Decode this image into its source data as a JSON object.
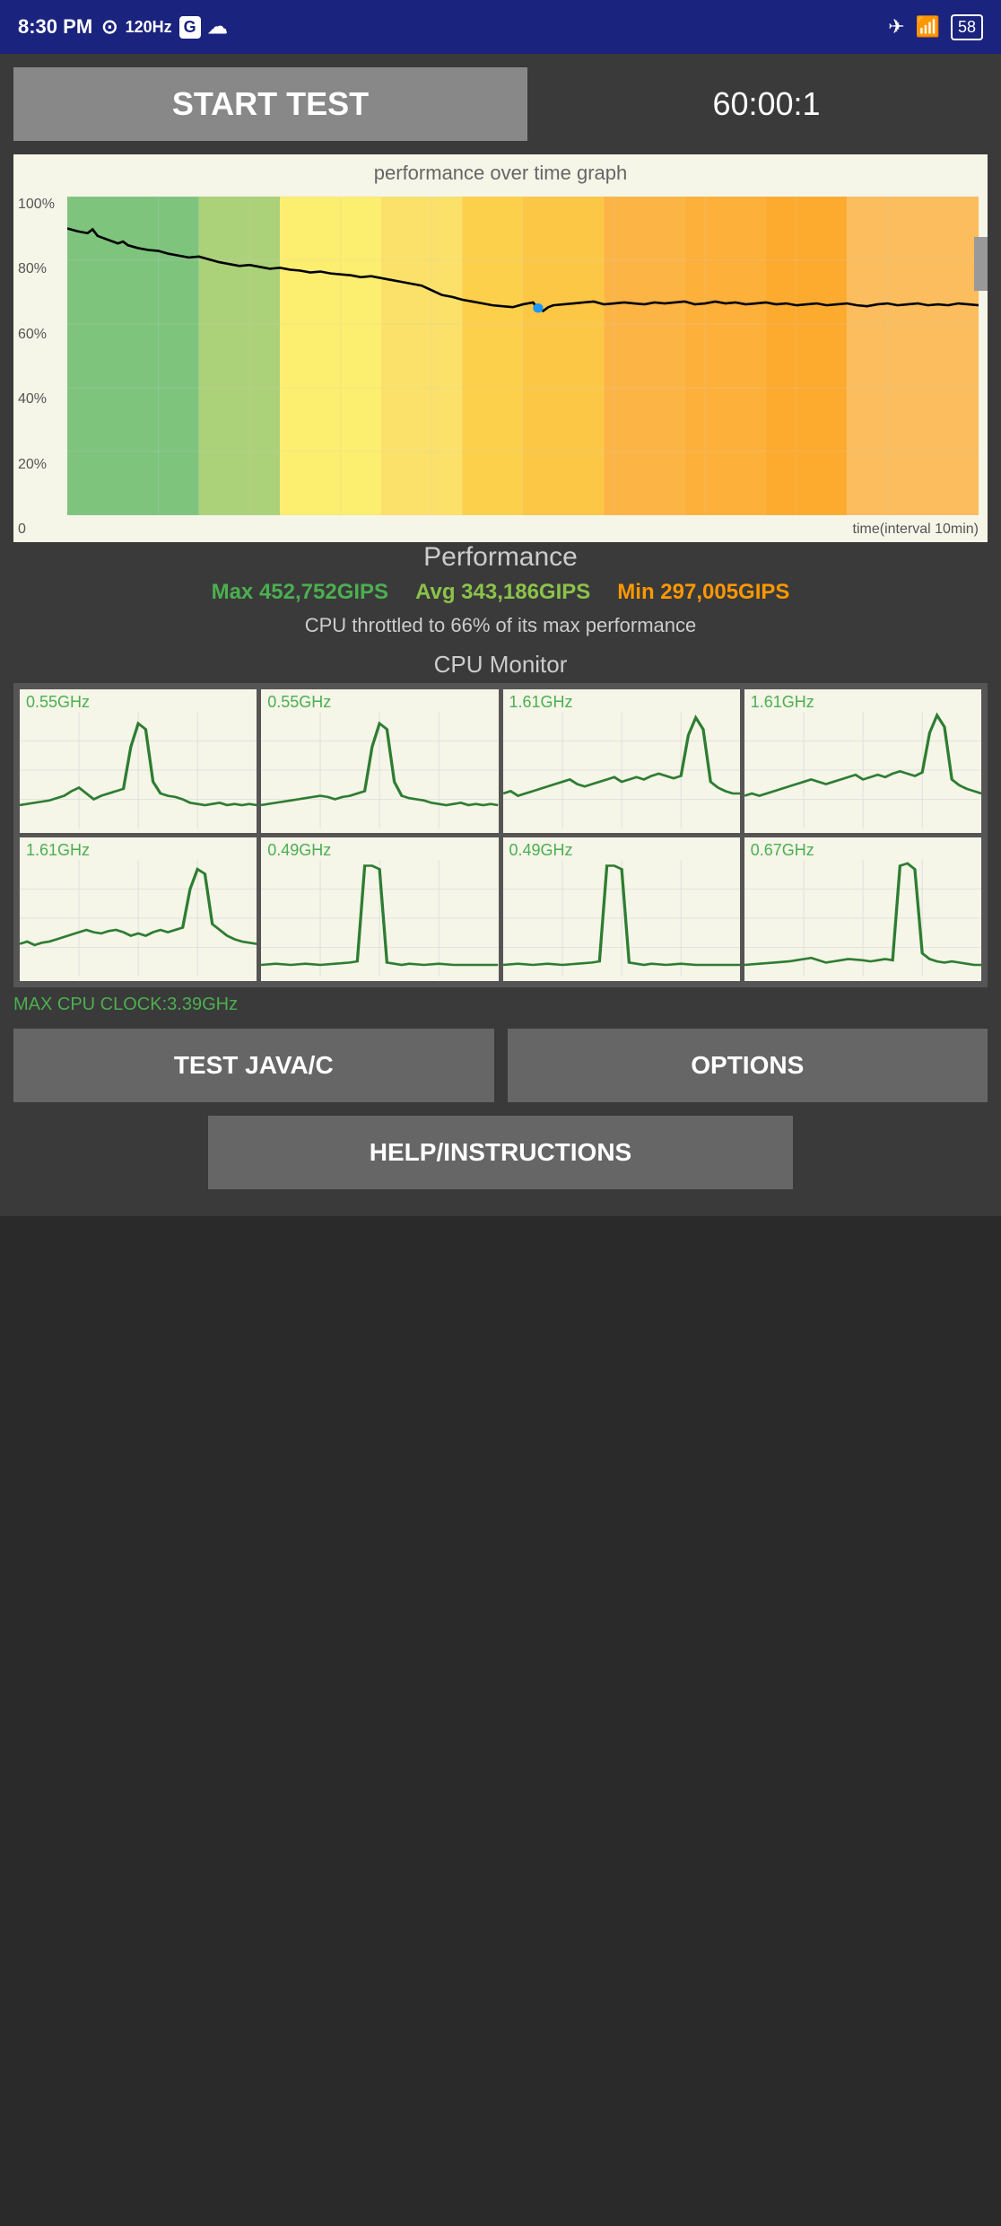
{
  "statusBar": {
    "time": "8:30 PM",
    "hz": "120Hz",
    "battery": "58"
  },
  "topControls": {
    "startTestLabel": "START TEST",
    "timerValue": "60:00:1"
  },
  "graph": {
    "title": "performance over time graph",
    "yLabels": [
      "100%",
      "80%",
      "60%",
      "40%",
      "20%",
      "0"
    ],
    "timeLabel": "time(interval 10min)"
  },
  "performance": {
    "title": "Performance",
    "maxLabel": "Max 452,752GIPS",
    "avgLabel": "Avg 343,186GIPS",
    "minLabel": "Min 297,005GIPS",
    "throttleText": "CPU throttled to 66% of its max performance"
  },
  "cpuMonitor": {
    "title": "CPU Monitor",
    "cells": [
      {
        "freq": "0.55GHz"
      },
      {
        "freq": "0.55GHz"
      },
      {
        "freq": "1.61GHz"
      },
      {
        "freq": "1.61GHz"
      },
      {
        "freq": "1.61GHz"
      },
      {
        "freq": "0.49GHz"
      },
      {
        "freq": "0.49GHz"
      },
      {
        "freq": "0.67GHz"
      }
    ],
    "maxCpuClock": "MAX CPU CLOCK:3.39GHz"
  },
  "buttons": {
    "testJavaC": "TEST JAVA/C",
    "options": "OPTIONS",
    "helpInstructions": "HELP/INSTRUCTIONS"
  }
}
